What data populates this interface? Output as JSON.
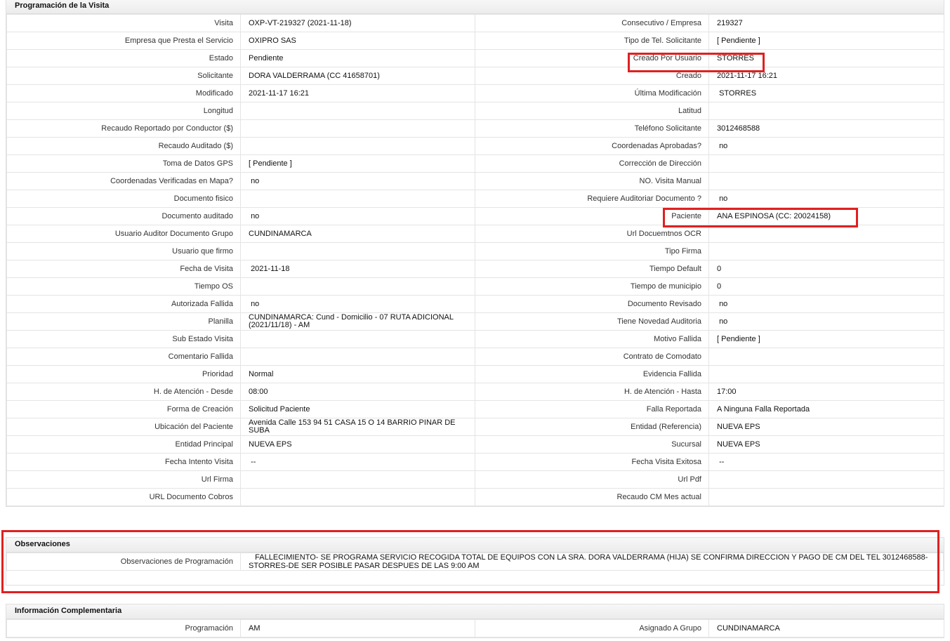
{
  "section1": {
    "title": "Programación de la Visita",
    "rows": [
      {
        "l1": "Visita",
        "v1": "OXP-VT-219327 (2021-11-18)",
        "l2": "Consecutivo / Empresa",
        "v2": "219327"
      },
      {
        "l1": "Empresa que Presta el Servicio",
        "v1": "OXIPRO SAS",
        "l2": "Tipo de Tel. Solicitante",
        "v2": "[ Pendiente ]"
      },
      {
        "l1": "Estado",
        "v1": "Pendiente",
        "l2": "Creado Por Usuario",
        "v2": "STORRES"
      },
      {
        "l1": "Solicitante",
        "v1": "DORA VALDERRAMA (CC 41658701)",
        "l2": "Creado",
        "v2": "2021-11-17 16:21"
      },
      {
        "l1": "Modificado",
        "v1": "2021-11-17 16:21",
        "l2": "Última Modificación",
        "v2": " STORRES"
      },
      {
        "l1": "Longitud",
        "v1": "",
        "l2": "Latitud",
        "v2": ""
      },
      {
        "l1": "Recaudo Reportado por Conductor ($)",
        "v1": "",
        "l2": "Teléfono Solicitante",
        "v2": "3012468588"
      },
      {
        "l1": "Recaudo Auditado ($)",
        "v1": "",
        "l2": "Coordenadas Aprobadas?",
        "v2": " no"
      },
      {
        "l1": "Toma de Datos GPS",
        "v1": "[ Pendiente ]",
        "l2": "Corrección de Dirección",
        "v2": ""
      },
      {
        "l1": "Coordenadas Verificadas en Mapa?",
        "v1": " no",
        "l2": "NO. Visita Manual",
        "v2": ""
      },
      {
        "l1": "Documento fisico",
        "v1": "",
        "l2": "Requiere Auditoriar Documento ?",
        "v2": " no"
      },
      {
        "l1": "Documento auditado",
        "v1": " no",
        "l2": "Paciente",
        "v2": "ANA ESPINOSA (CC: 20024158)"
      },
      {
        "l1": "Usuario Auditor Documento Grupo",
        "v1": "CUNDINAMARCA",
        "l2": "Url Docuemtnos OCR",
        "v2": ""
      },
      {
        "l1": "Usuario que firmo",
        "v1": "",
        "l2": "Tipo Firma",
        "v2": ""
      },
      {
        "l1": "Fecha de Visita",
        "v1": " 2021-11-18",
        "l2": "Tiempo Default",
        "v2": "0"
      },
      {
        "l1": "Tiempo OS",
        "v1": "",
        "l2": "Tiempo de municipio",
        "v2": "0"
      },
      {
        "l1": "Autorizada Fallida",
        "v1": " no",
        "l2": "Documento Revisado",
        "v2": " no"
      },
      {
        "l1": "Planilla",
        "v1": "CUNDINAMARCA: Cund - Domicilio - 07 RUTA ADICIONAL (2021/11/18) - AM",
        "l2": "Tiene Novedad Auditoria",
        "v2": " no"
      },
      {
        "l1": "Sub Estado Visita",
        "v1": "",
        "l2": "Motivo Fallida",
        "v2": "[ Pendiente ]"
      },
      {
        "l1": "Comentario Fallida",
        "v1": "",
        "l2": "Contrato de Comodato",
        "v2": ""
      },
      {
        "l1": "Prioridad",
        "v1": "Normal",
        "l2": "Evidencia Fallida",
        "v2": ""
      },
      {
        "l1": "H. de Atención - Desde",
        "v1": "08:00",
        "l2": "H. de Atención - Hasta",
        "v2": "17:00"
      },
      {
        "l1": "Forma de Creación",
        "v1": "Solicitud Paciente",
        "l2": "Falla Reportada",
        "v2": "A Ninguna Falla Reportada"
      },
      {
        "l1": "Ubicación del Paciente",
        "v1": "Avenida Calle 153 94 51 CASA 15 O 14 BARRIO PINAR DE SUBA",
        "l2": "Entidad (Referencia)",
        "v2": "NUEVA EPS"
      },
      {
        "l1": "Entidad Principal",
        "v1": "NUEVA EPS",
        "l2": "Sucursal",
        "v2": "NUEVA EPS"
      },
      {
        "l1": "Fecha Intento Visita",
        "v1": " --",
        "l2": "Fecha Visita Exitosa",
        "v2": " --"
      },
      {
        "l1": "Url Firma",
        "v1": "",
        "l2": "Url Pdf",
        "v2": ""
      },
      {
        "l1": "URL Documento Cobros",
        "v1": "",
        "l2": "Recaudo CM Mes actual",
        "v2": ""
      }
    ]
  },
  "section2": {
    "title": "Observaciones",
    "label": "Observaciones de Programación",
    "value": "   FALLECIMIENTO- SE PROGRAMA SERVICIO RECOGIDA TOTAL DE EQUIPOS CON LA SRA. DORA VALDERRAMA (HIJA) SE CONFIRMA DIRECCION Y PAGO DE CM DEL TEL 3012468588- STORRES-DE SER POSIBLE PASAR DESPUES DE LAS 9:00 AM"
  },
  "section3": {
    "title": "Información Complementaria",
    "rows": [
      {
        "l1": "Programación",
        "v1": "AM",
        "l2": "Asignado A Grupo",
        "v2": "CUNDINAMARCA"
      }
    ]
  },
  "colors": {
    "highlight": "#e02020",
    "border": "#e4e4e4"
  }
}
